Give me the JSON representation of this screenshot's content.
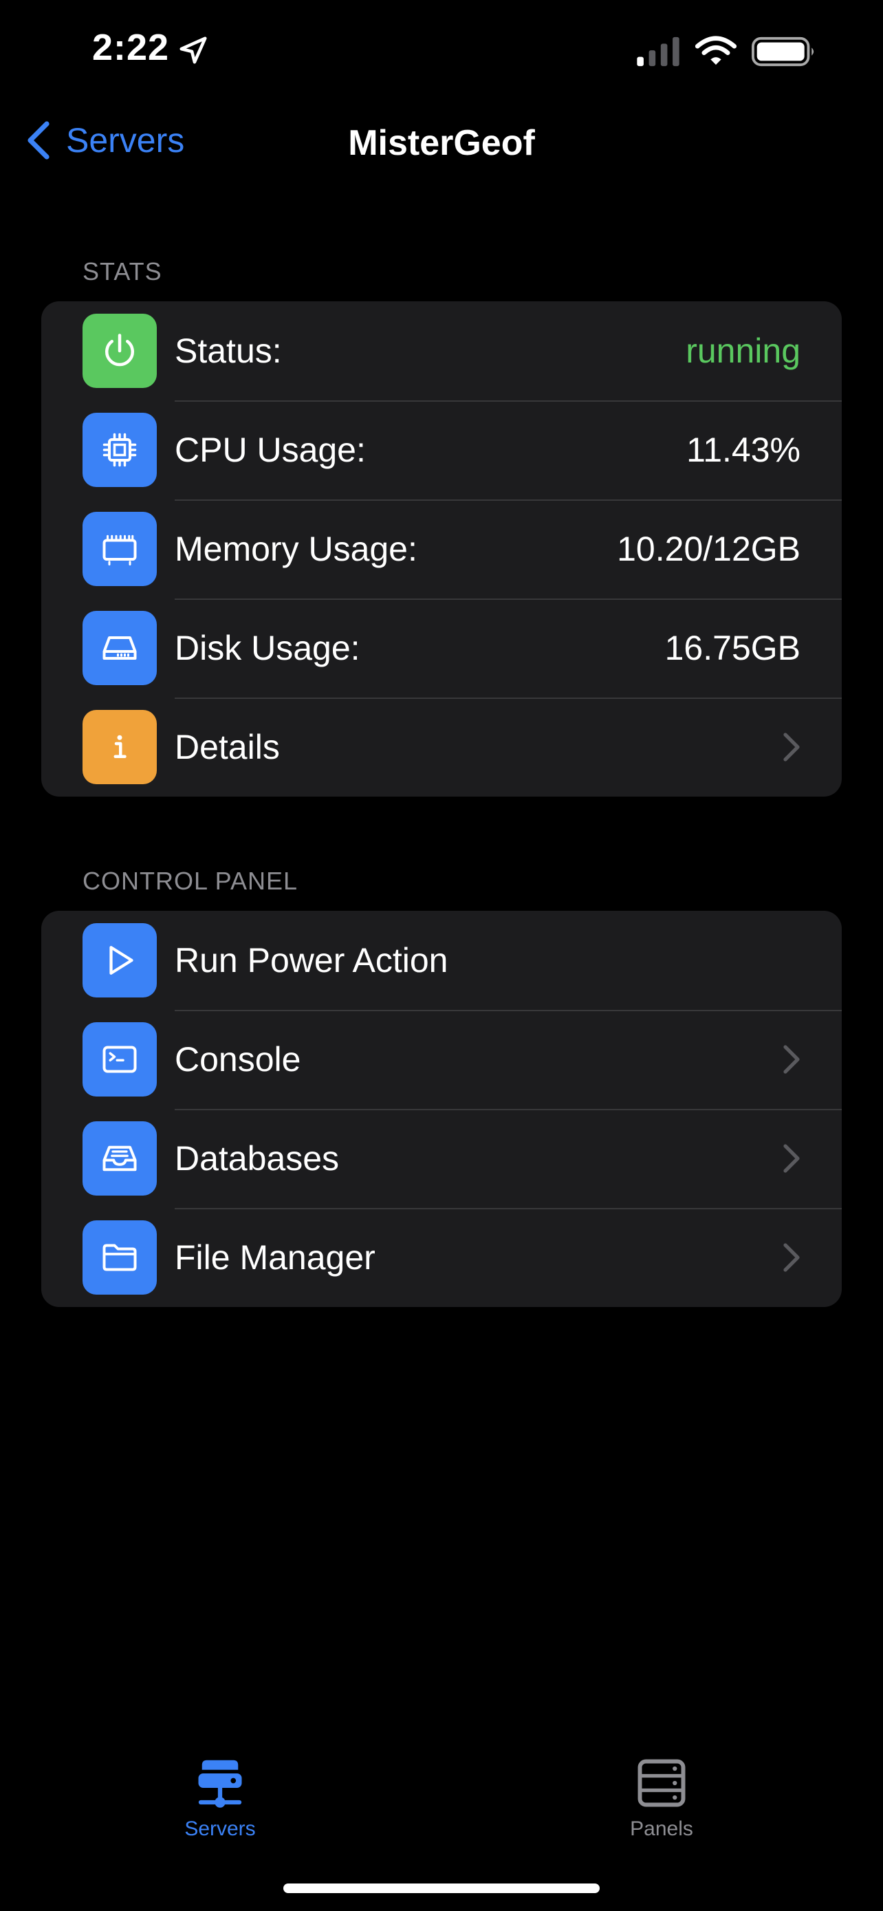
{
  "status_bar": {
    "time": "2:22"
  },
  "nav": {
    "back_label": "Servers",
    "title": "MisterGeof"
  },
  "stats": {
    "header": "STATS",
    "rows": [
      {
        "label": "Status:",
        "value": "running",
        "icon": "power-icon",
        "color": "#5ac85f",
        "value_color": "#5ac85f"
      },
      {
        "label": "CPU Usage:",
        "value": "11.43%",
        "icon": "cpu-icon",
        "color": "#3b82f6"
      },
      {
        "label": "Memory Usage:",
        "value": "10.20/12GB",
        "icon": "memory-icon",
        "color": "#3b82f6"
      },
      {
        "label": "Disk Usage:",
        "value": "16.75GB",
        "icon": "disk-icon",
        "color": "#3b82f6"
      },
      {
        "label": "Details",
        "icon": "info-icon",
        "color": "#f0a23a"
      }
    ]
  },
  "control_panel": {
    "header": "CONTROL PANEL",
    "rows": [
      {
        "label": "Run Power Action",
        "icon": "play-icon",
        "color": "#3b82f6"
      },
      {
        "label": "Console",
        "icon": "terminal-icon",
        "color": "#3b82f6"
      },
      {
        "label": "Databases",
        "icon": "tray-icon",
        "color": "#3b82f6"
      },
      {
        "label": "File Manager",
        "icon": "folder-icon",
        "color": "#3b82f6"
      }
    ]
  },
  "tab_bar": {
    "tabs": [
      {
        "label": "Servers",
        "icon": "server-stack-icon",
        "active": true,
        "color": "#3b82f6"
      },
      {
        "label": "Panels",
        "icon": "panels-icon",
        "active": false,
        "color": "#8e8e93"
      }
    ]
  }
}
